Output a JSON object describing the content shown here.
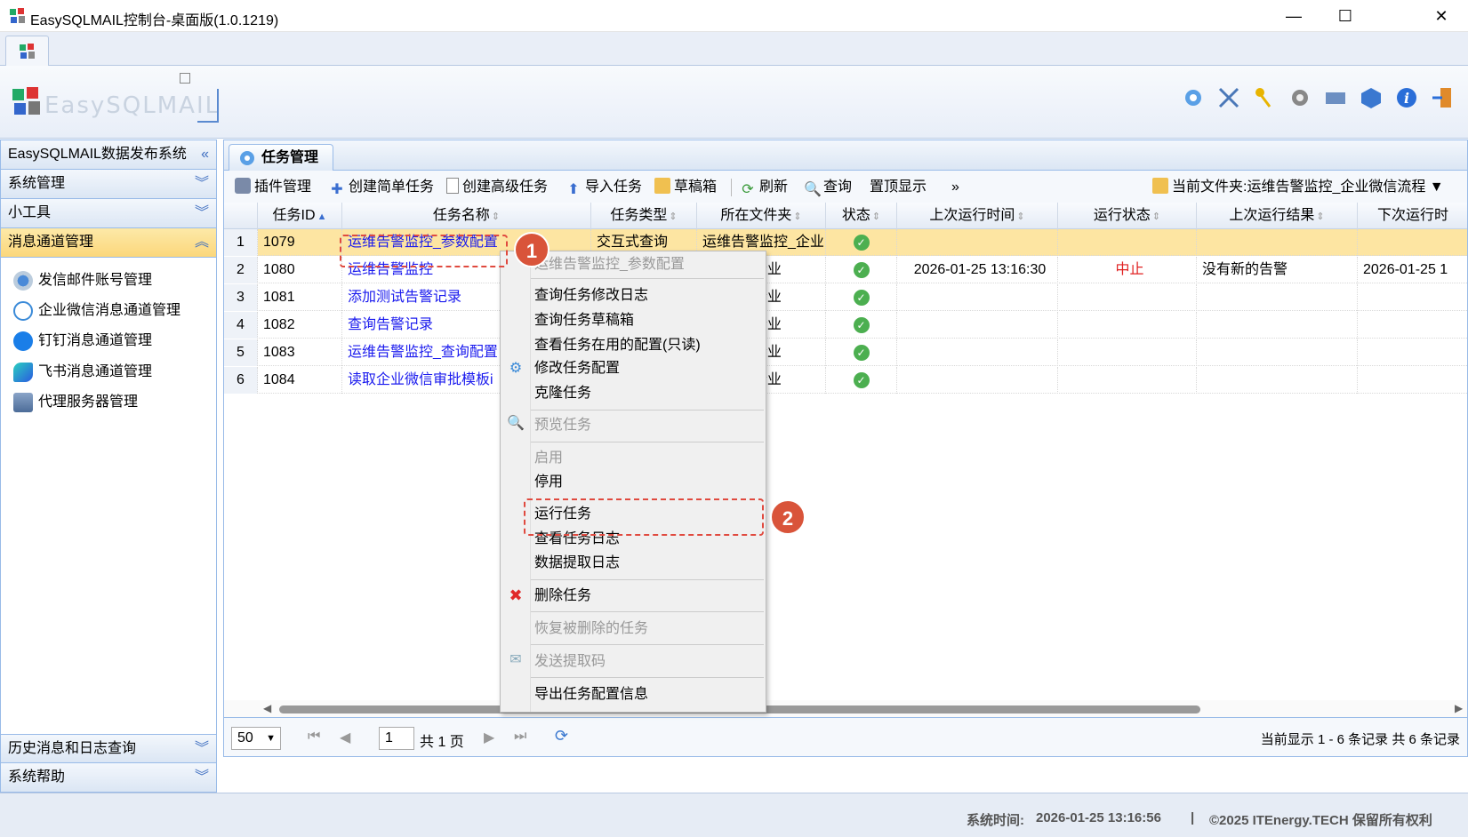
{
  "window": {
    "title": "EasySQLMAIL控制台-桌面版(1.0.1219)",
    "min": "—",
    "max": "☐",
    "close": "✕"
  },
  "banner": {
    "logo_text": "EasySQLMAIL"
  },
  "sidebar": {
    "top_header": "EasySQLMAIL数据发布系统",
    "sections": [
      "系统管理",
      "小工具",
      "消息通道管理"
    ],
    "items": [
      {
        "label": "发信邮件账号管理",
        "icon": "mail-account-icon"
      },
      {
        "label": "企业微信消息通道管理",
        "icon": "wecom-icon"
      },
      {
        "label": "钉钉消息通道管理",
        "icon": "dingtalk-icon"
      },
      {
        "label": "飞书消息通道管理",
        "icon": "feishu-icon"
      },
      {
        "label": "代理服务器管理",
        "icon": "proxy-server-icon"
      }
    ],
    "bottom_sections": [
      "历史消息和日志查询",
      "系统帮助"
    ]
  },
  "main": {
    "tab_label": "任务管理",
    "toolbar": {
      "plugin": "插件管理",
      "simple_task": "创建简单任务",
      "advanced_task": "创建高级任务",
      "import": "导入任务",
      "drafts": "草稿箱",
      "refresh": "刷新",
      "query": "查询",
      "pin": "置顶显示",
      "more": "»",
      "current_folder": "当前文件夹:运维告警监控_企业微信流程 ▼"
    },
    "columns": [
      "任务ID",
      "任务名称",
      "任务类型",
      "所在文件夹",
      "状态",
      "上次运行时间",
      "运行状态",
      "上次运行结果",
      "下次运行时"
    ],
    "rows": [
      {
        "n": "1",
        "id": "1079",
        "name": "运维告警监控_参数配置",
        "type": "交互式查询",
        "folder": "运维告警监控_企业",
        "last": "",
        "runstate": "",
        "result": "",
        "next": ""
      },
      {
        "n": "2",
        "id": "1080",
        "name": "运维告警监控",
        "type": "",
        "folder": "警监控_企业",
        "last": "2026-01-25 13:16:30",
        "runstate": "中止",
        "result": "没有新的告警",
        "next": "2026-01-25 1"
      },
      {
        "n": "3",
        "id": "1081",
        "name": "添加测试告警记录",
        "type": "",
        "folder": "警监控_企业",
        "last": "",
        "runstate": "",
        "result": "",
        "next": ""
      },
      {
        "n": "4",
        "id": "1082",
        "name": "查询告警记录",
        "type": "",
        "folder": "警监控_企业",
        "last": "",
        "runstate": "",
        "result": "",
        "next": ""
      },
      {
        "n": "5",
        "id": "1083",
        "name": "运维告警监控_查询配置",
        "type": "",
        "folder": "警监控_企业",
        "last": "",
        "runstate": "",
        "result": "",
        "next": ""
      },
      {
        "n": "6",
        "id": "1084",
        "name": "读取企业微信审批模板i",
        "type": "",
        "folder": "警监控_企业",
        "last": "",
        "runstate": "",
        "result": "",
        "next": ""
      }
    ],
    "pager": {
      "page_size": "50",
      "page": "1",
      "total_pages": "共 1 页",
      "summary": "当前显示 1 - 6 条记录 共 6 条记录"
    }
  },
  "context_menu": {
    "header": "运维告警监控_参数配置",
    "items": [
      "查询任务修改日志",
      "查询任务草稿箱",
      "查看任务在用的配置(只读)",
      "修改任务配置",
      "克隆任务",
      "预览任务",
      "启用",
      "停用",
      "运行任务",
      "查看任务日志",
      "数据提取日志",
      "删除任务",
      "恢复被删除的任务",
      "发送提取码",
      "导出任务配置信息"
    ]
  },
  "callouts": {
    "one": "1",
    "two": "2"
  },
  "statusbar": {
    "time_label": "系统时间:",
    "time": "2026-01-25 13:16:56",
    "sep": "|",
    "copyright": "©2025 ITEnergy.TECH 保留所有权利"
  },
  "colors": {
    "accent": "#99bbe8",
    "selected_row": "#fde5a2",
    "link": "#1a1aee",
    "stopped": "#e02020",
    "callout": "#d9543a"
  }
}
